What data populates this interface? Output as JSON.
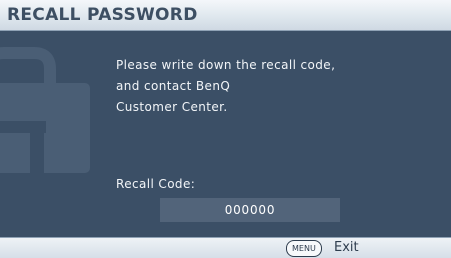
{
  "dialog": {
    "title": "RECALL PASSWORD"
  },
  "message": {
    "lines": [
      "Please write down the recall code,",
      "and contact BenQ",
      "Customer Center."
    ]
  },
  "recall_code": {
    "label": "Recall Code:",
    "value": "000000"
  },
  "footer": {
    "menu_key": "MENU",
    "exit_label": "Exit"
  },
  "colors": {
    "panel_background": "#3b4f66",
    "code_box": "#52647a",
    "title_text": "#3d4f63",
    "body_text": "#f2f5f8"
  },
  "icons": {
    "background": "lock-icon",
    "footer_key": "menu-key-icon"
  }
}
